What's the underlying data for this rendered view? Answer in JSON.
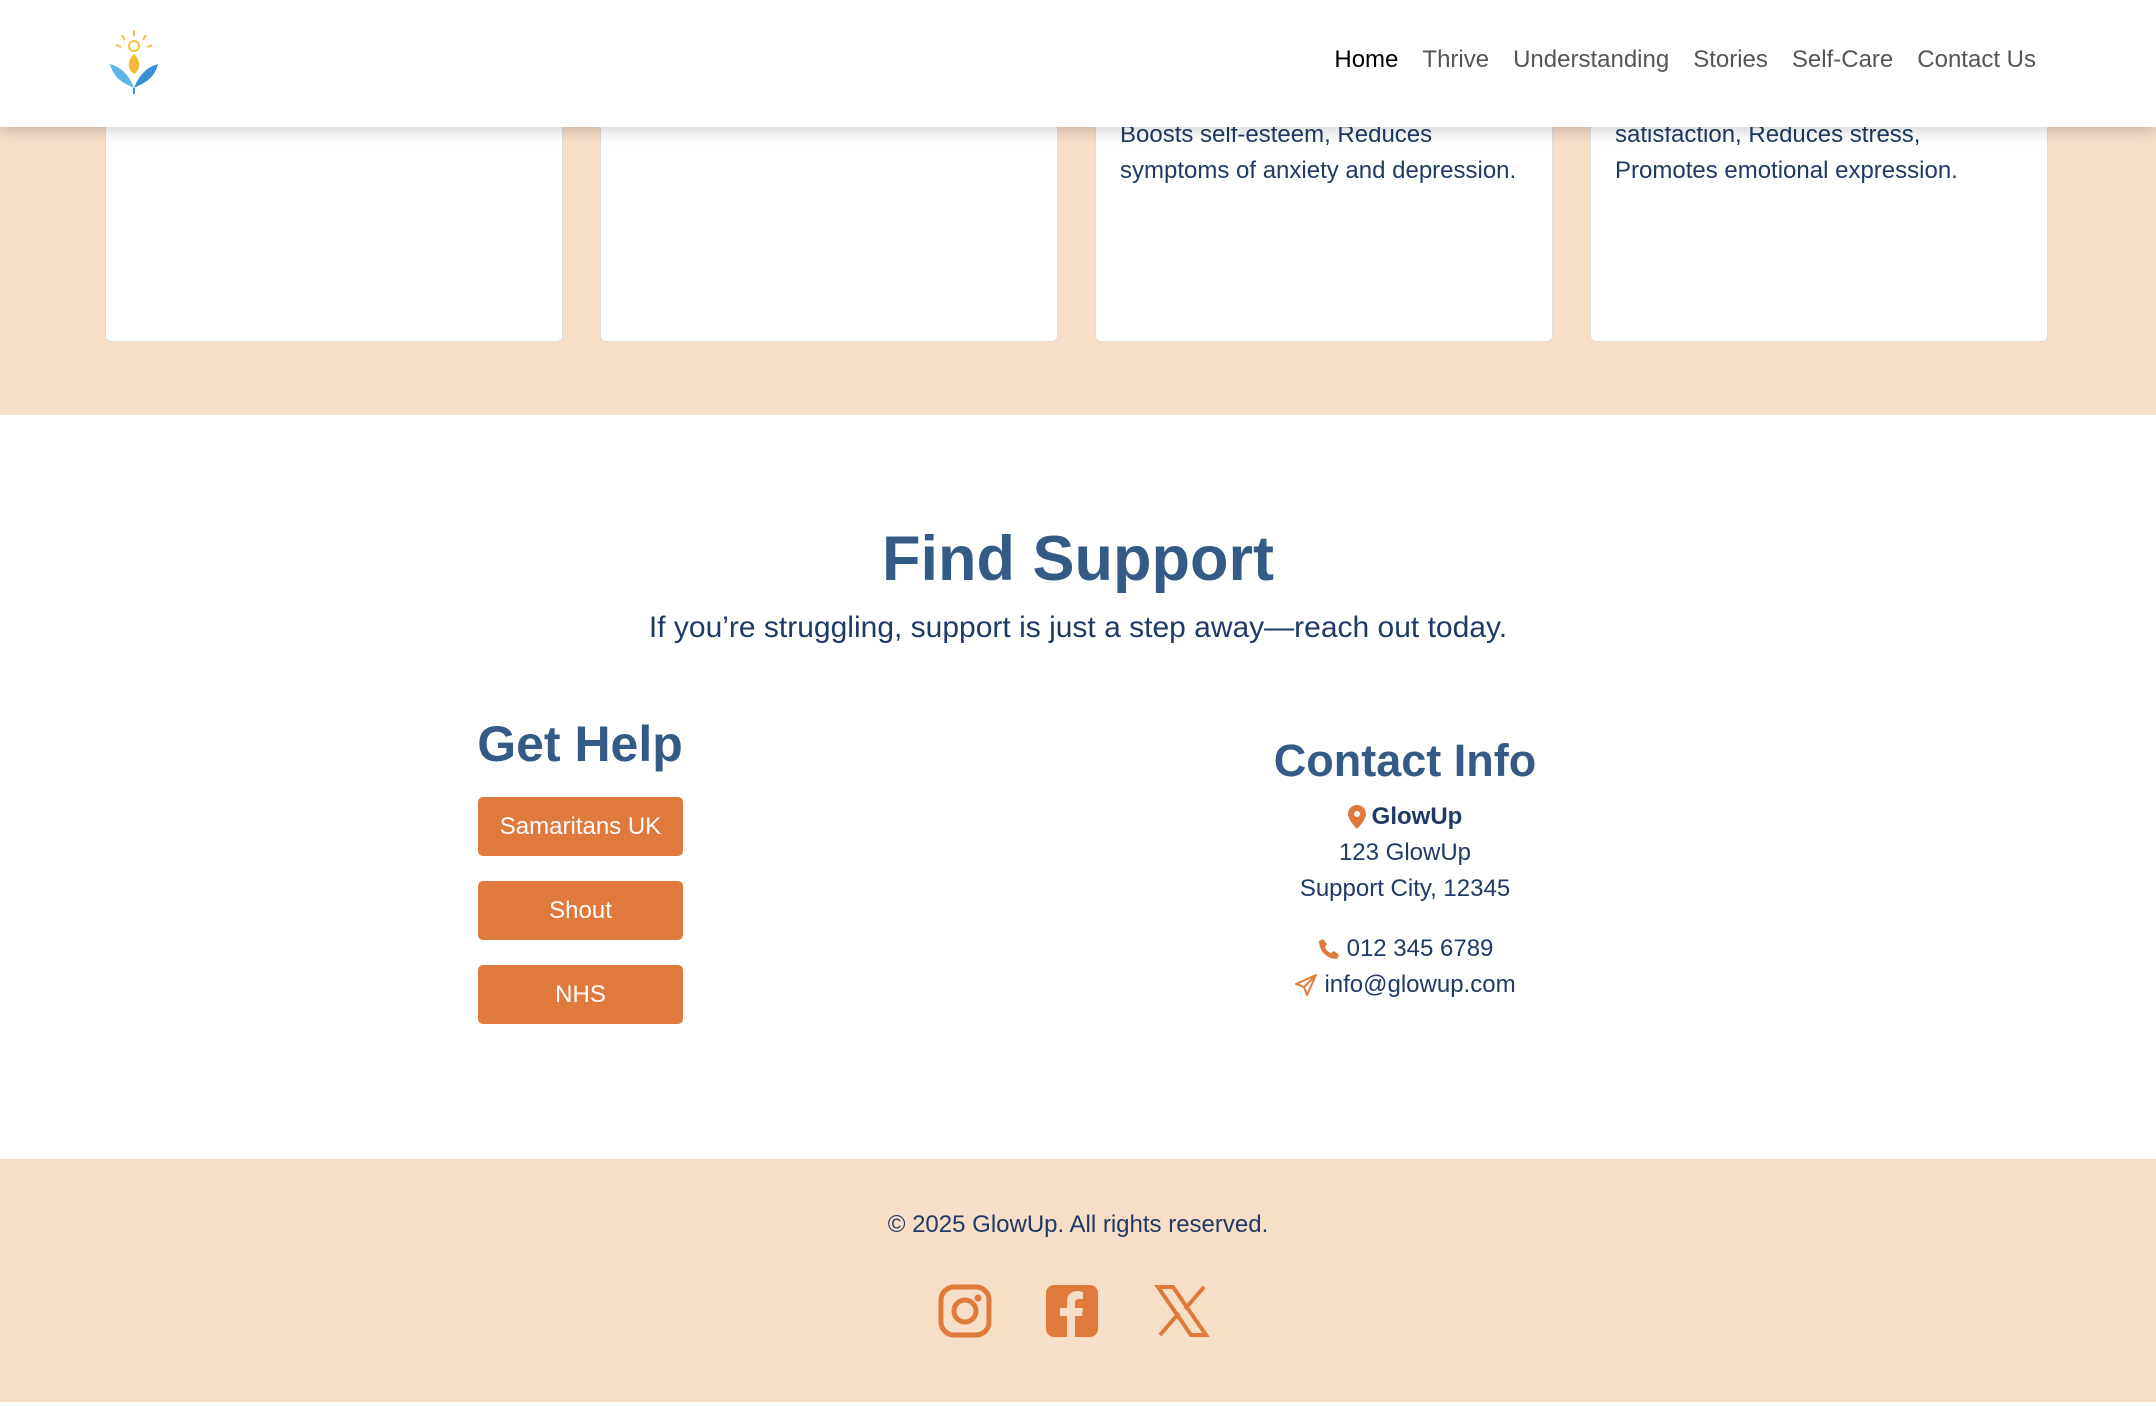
{
  "nav": {
    "items": [
      "Home",
      "Thrive",
      "Understanding",
      "Stories",
      "Self-Care",
      "Contact Us"
    ],
    "active": "Home"
  },
  "cards": [
    {
      "text": ""
    },
    {
      "text": ""
    },
    {
      "text": "Boosts self-esteem, Reduces symptoms of anxiety and depression."
    },
    {
      "text": "satisfaction, Reduces stress, Promotes emotional expression."
    }
  ],
  "support": {
    "title": "Find Support",
    "subtitle": "If you’re struggling, support is just a step away—reach out today."
  },
  "get_help": {
    "title": "Get Help",
    "buttons": [
      "Samaritans UK",
      "Shout",
      "NHS"
    ]
  },
  "contact": {
    "title": "Contact Info",
    "name": "GlowUp",
    "address1": "123 GlowUp",
    "address2": "Support City, 12345",
    "phone": "012 345 6789",
    "email": "info@glowup.com"
  },
  "footer": {
    "copyright": "© 2025 GlowUp. All rights reserved.",
    "social": [
      "instagram-icon",
      "facebook-icon",
      "x-icon"
    ]
  },
  "colors": {
    "accent": "#e07a3c",
    "peach": "#f6dec7",
    "heading": "#345a86",
    "text": "#1f3a66"
  }
}
